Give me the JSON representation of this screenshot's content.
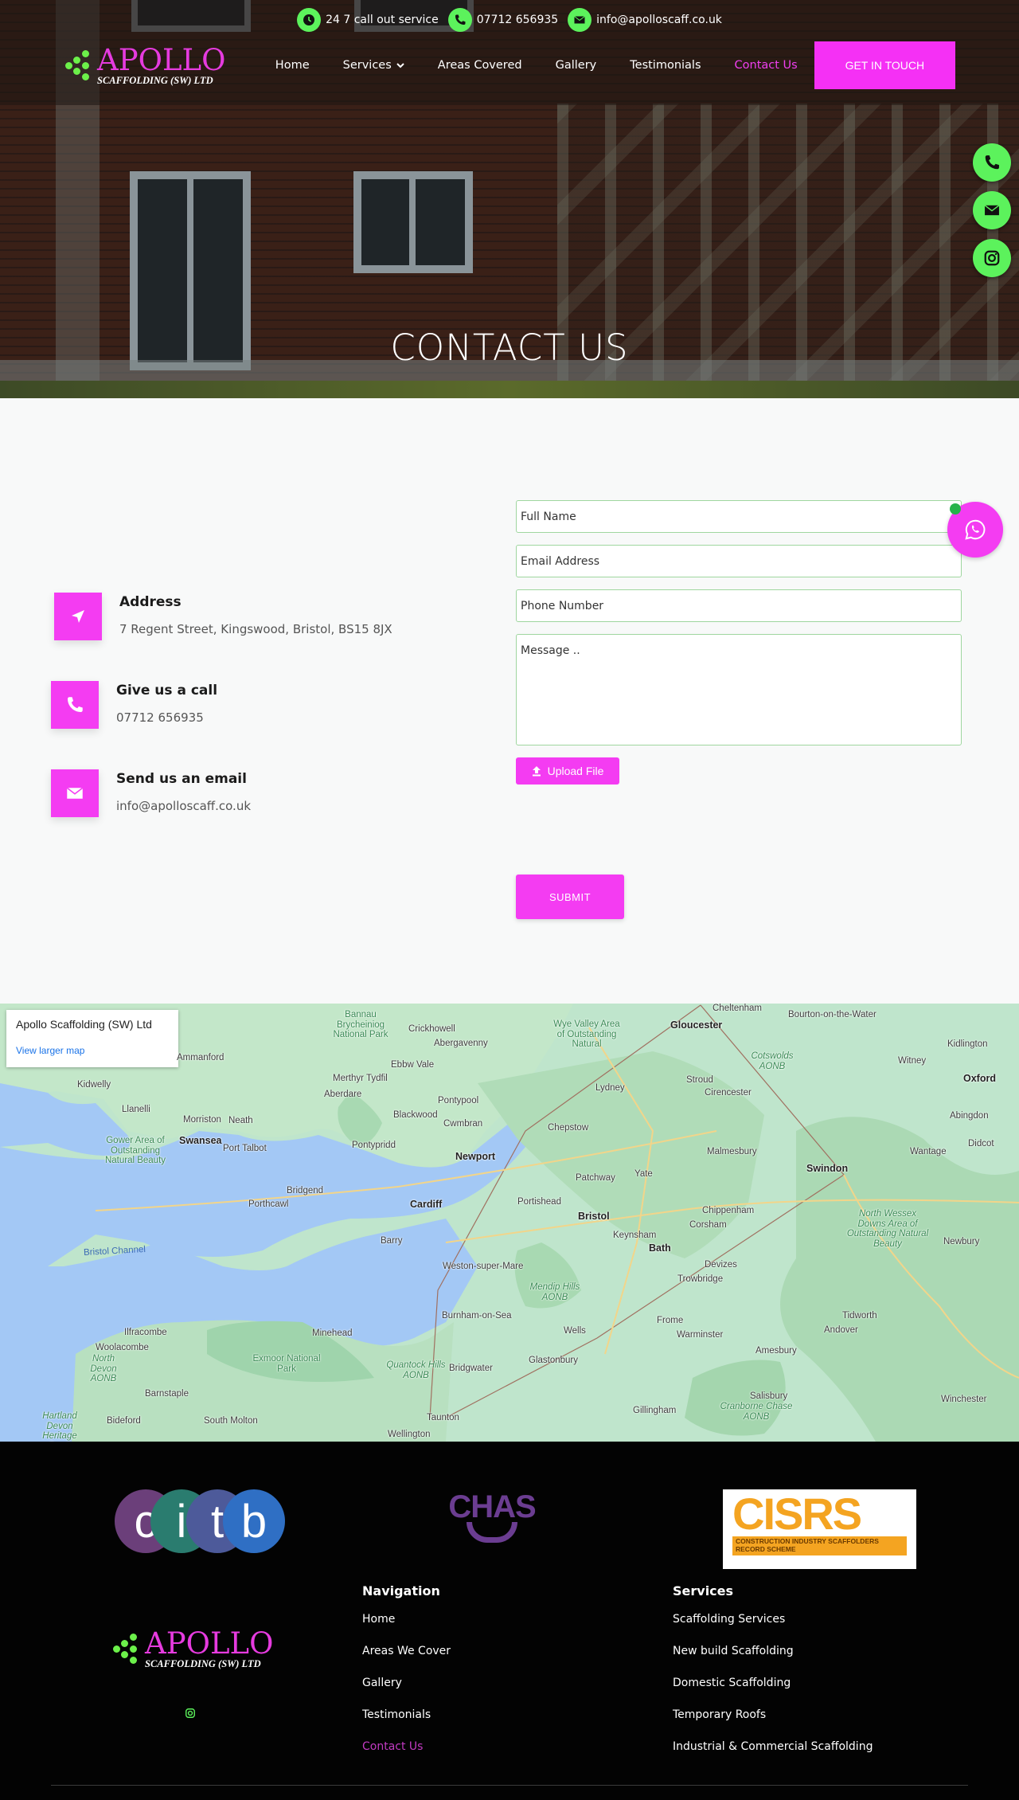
{
  "colors": {
    "brand_pink": "#f43cf2",
    "brand_green": "#5cf25c",
    "footer_bg": "#030303"
  },
  "topbar": {
    "items": [
      {
        "icon": "clock-icon",
        "text": "24 7 call out service"
      },
      {
        "icon": "phone-icon",
        "text": "07712 656935"
      },
      {
        "icon": "envelope-icon",
        "text": "info@apolloscaff.co.uk"
      }
    ]
  },
  "logo": {
    "main": "APOLLO",
    "sub": "SCAFFOLDING (SW) LTD"
  },
  "nav": {
    "items": [
      {
        "label": "Home"
      },
      {
        "label": "Services",
        "has_dropdown": true
      },
      {
        "label": "Areas Covered"
      },
      {
        "label": "Gallery"
      },
      {
        "label": "Testimonials"
      },
      {
        "label": "Contact Us",
        "active": true
      }
    ],
    "cta_label": "GET IN TOUCH"
  },
  "hero": {
    "title": "CONTACT US"
  },
  "floating_buttons": [
    {
      "icon": "phone-icon"
    },
    {
      "icon": "envelope-icon"
    },
    {
      "icon": "instagram-icon"
    }
  ],
  "contact_info": [
    {
      "icon": "location-arrow-icon",
      "title": "Address",
      "value": "7 Regent Street, Kingswood, Bristol, BS15 8JX"
    },
    {
      "icon": "phone-icon",
      "title": "Give us a call",
      "value": "07712 656935"
    },
    {
      "icon": "envelope-icon",
      "title": "Send us an email",
      "value": "info@apolloscaff.co.uk"
    }
  ],
  "form": {
    "full_name_placeholder": "Full Name",
    "email_placeholder": "Email Address",
    "phone_placeholder": "Phone Number",
    "message_placeholder": "Message ..",
    "upload_label": "Upload File",
    "submit_label": "SUBMIT"
  },
  "map": {
    "card_title": "Apollo Scaffolding (SW) Ltd",
    "card_link": "View larger map",
    "labels": {
      "cities": [
        "Cheltenham",
        "Gloucester",
        "Swindon",
        "Oxford",
        "Newport",
        "Cardiff",
        "Bristol",
        "Bath",
        "Swansea",
        "Bourton-on-the-Water",
        "Kidlington",
        "Witney",
        "Stroud",
        "Cirencester",
        "Abingdon",
        "Didcot",
        "Wantage",
        "Malmesbury",
        "Chippenham",
        "Corsham",
        "Yate",
        "Patchway",
        "Portishead",
        "Keynsham",
        "Lydney",
        "Chepstow",
        "Crickhowell",
        "Abergavenny",
        "Ebbw Vale",
        "Merthyr Tydfil",
        "Aberdare",
        "Pontypool",
        "Blackwood",
        "Cwmbran",
        "Pontypridd",
        "Llanelli",
        "Kidwelly",
        "Morriston",
        "Neath",
        "Port Talbot",
        "Bridgend",
        "Porthcawl",
        "Barry",
        "Weston-super-Mare",
        "Burnham-on-Sea",
        "Bridgwater",
        "Taunton",
        "Wellington",
        "Minehead",
        "Ilfracombe",
        "Woolacombe",
        "Barnstaple",
        "Bideford",
        "South Molton",
        "Wells",
        "Glastonbury",
        "Frome",
        "Warminster",
        "Trowbridge",
        "Devizes",
        "Tidworth",
        "Andover",
        "Amesbury",
        "Salisbury",
        "Winchester",
        "Newbury",
        "Gillingham",
        "Ammanford"
      ],
      "parks": [
        "Bannau Brycheiniog National Park",
        "Wye Valley Area of Outstanding Natural",
        "Gower Area of Outstanding Natural Beauty",
        "Cotswolds AONB",
        "North Wessex Downs Area of Outstanding Natural Beauty",
        "Mendip Hills AONB",
        "Quantock Hills AONB",
        "Exmoor National Park",
        "North Devon AONB",
        "Cranborne Chase AONB",
        "Hartland Devon Heritage Coast"
      ],
      "sea": "Bristol Channel"
    }
  },
  "footer": {
    "badges": [
      "citb",
      "CHAS",
      "CISRS"
    ],
    "cisrs_sub": "CONSTRUCTION INDUSTRY SCAFFOLDERS RECORD SCHEME",
    "navigation": {
      "heading": "Navigation",
      "links": [
        {
          "label": "Home"
        },
        {
          "label": "Areas We Cover"
        },
        {
          "label": "Gallery"
        },
        {
          "label": "Testimonials"
        },
        {
          "label": "Contact Us",
          "active": true
        }
      ]
    },
    "services": {
      "heading": "Services",
      "links": [
        {
          "label": "Scaffolding Services"
        },
        {
          "label": "New build Scaffolding"
        },
        {
          "label": "Domestic Scaffolding"
        },
        {
          "label": "Temporary Roofs"
        },
        {
          "label": "Industrial & Commercial Scaffolding"
        }
      ]
    }
  }
}
